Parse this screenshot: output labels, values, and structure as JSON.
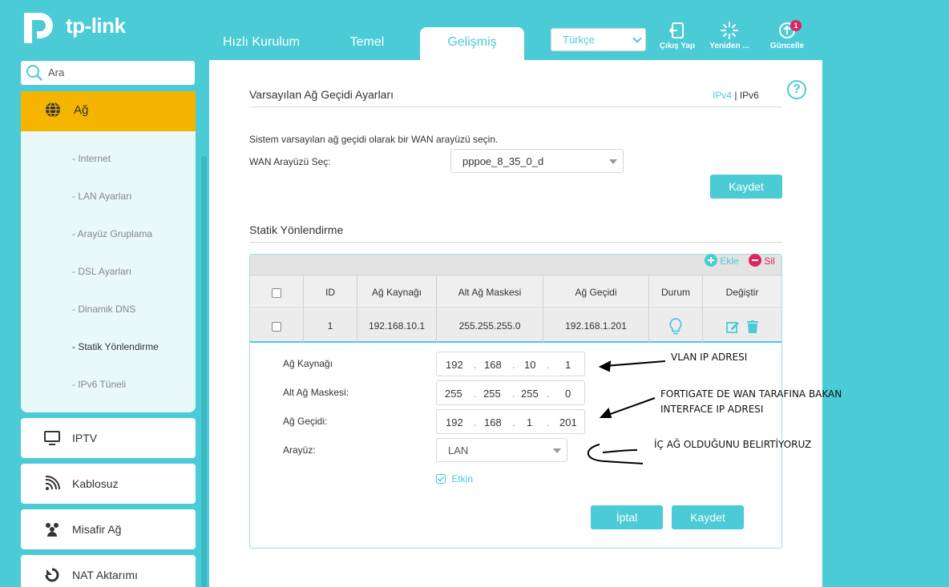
{
  "header": {
    "logo_text": "tp-link",
    "tabs": [
      {
        "label": "Hızlı Kurulum"
      },
      {
        "label": "Temel"
      },
      {
        "label": "Gelişmiş"
      }
    ],
    "language": "Türkçe",
    "buttons": {
      "logout": "Çıkış Yap",
      "reboot": "Yeniden ...",
      "update": "Güncelle",
      "update_badge": "1"
    }
  },
  "sidebar": {
    "search_placeholder": "Ara",
    "group": "Ağ",
    "sub_items": [
      "- Internet",
      "- LAN Ayarları",
      "- Arayüz Gruplama",
      "- DSL Ayarları",
      "- Dinamik DNS",
      "- Statik Yönlendirme",
      "- IPv6 Tüneli"
    ],
    "items": [
      "IPTV",
      "Kablosuz",
      "Misafir Ağ",
      "NAT Aktarımı"
    ]
  },
  "gateway": {
    "title": "Varsayılan Ağ Geçidi Ayarları",
    "ipv4": "IPv4",
    "sep": "|",
    "ipv6": "IPv6",
    "help": "?",
    "description": "Sistem varsayılan ağ geçidi olarak bir WAN arayüzü seçin.",
    "wan_label": "WAN Arayüzü Seç:",
    "wan_value": "pppoe_8_35_0_d",
    "save": "Kaydet"
  },
  "routing": {
    "title": "Statik Yönlendirme",
    "add": "Ekle",
    "delete": "Sil",
    "columns": [
      "ID",
      "Ağ Kaynağı",
      "Alt Ağ Maskesi",
      "Ağ Geçidi",
      "Durum",
      "Değiştir"
    ],
    "row": {
      "id": "1",
      "source": "192.168.10.1",
      "mask": "255.255.255.0",
      "gateway": "192.168.1.201"
    },
    "form": {
      "source_label": "Ağ Kaynağı",
      "source": [
        "192",
        "168",
        "10",
        "1"
      ],
      "mask_label": "Alt Ağ Maskesi:",
      "mask": [
        "255",
        "255",
        "255",
        "0"
      ],
      "gateway_label": "Ağ Geçidi:",
      "gateway": [
        "192",
        "168",
        "1",
        "201"
      ],
      "iface_label": "Arayüz:",
      "iface": "LAN",
      "enabled": "Etkin",
      "cancel": "İptal",
      "save": "Kaydet"
    }
  },
  "annotations": {
    "vlan": "VLAN IP ADRESI",
    "fortigate_1": "FORTIGATE DE WAN TARAFINA BAKAN",
    "fortigate_2": "INTERFACE IP ADRESI",
    "lan": "İÇ AĞ OLDUĞUNU BELIRTİYORUZ"
  }
}
